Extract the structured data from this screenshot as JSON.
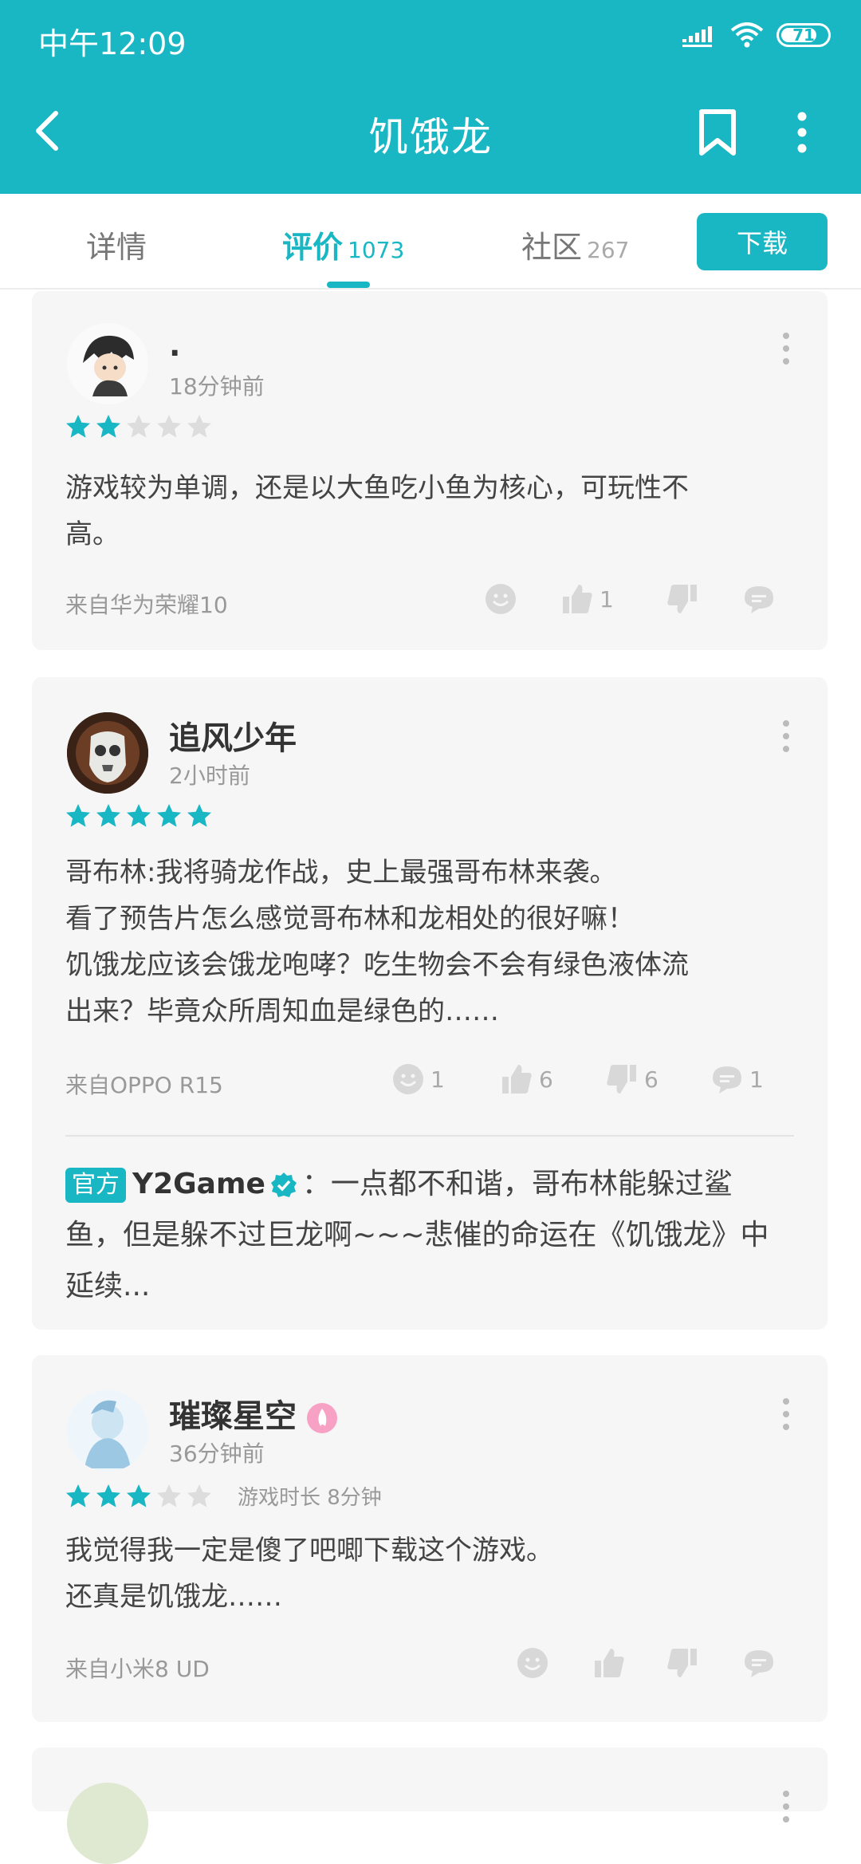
{
  "status_bar": {
    "time": "中午12:09",
    "battery": "71"
  },
  "header": {
    "title": "饥饿龙"
  },
  "tabs": [
    {
      "label": "详情",
      "count": ""
    },
    {
      "label": "评价",
      "count": "1073"
    },
    {
      "label": "社区",
      "count": "267"
    }
  ],
  "download_label": "下载",
  "colors": {
    "accent": "#19b6c4",
    "star_on": "#19b6c4",
    "star_off": "#dddddd",
    "card_bg": "#f6f6f6"
  },
  "reviews": [
    {
      "username": ".",
      "time": "18分钟前",
      "rating": 2,
      "text_lines": [
        "游戏较为单调，还是以大鱼吃小鱼为核心，可玩性不",
        "高。"
      ],
      "source": "来自华为荣耀10",
      "likes": "1"
    },
    {
      "username": "追风少年",
      "time": "2小时前",
      "rating": 5,
      "text_lines": [
        "哥布林:我将骑龙作战，史上最强哥布林来袭。",
        "看了预告片怎么感觉哥布林和龙相处的很好嘛！",
        "饥饿龙应该会饿龙咆哮？吃生物会不会有绿色液体流",
        "出来？毕竟众所周知血是绿色的……"
      ],
      "source": "来自OPPO R15",
      "emoji_count": "1",
      "likes": "6",
      "dislikes": "6",
      "comments": "1",
      "reply": {
        "badge": "官方",
        "name": "Y2Game",
        "lines": [
          "：一点都不和谐，哥布林能躲过鲨",
          "鱼，但是躲不过巨龙啊~~~悲催的命运在《饥饿龙》中",
          "延续..."
        ]
      }
    },
    {
      "username": "璀璨星空",
      "time": "36分钟前",
      "rating": 3,
      "play_time": "游戏时长 8分钟",
      "text_lines": [
        "我觉得我一定是傻了吧唧下载这个游戏。",
        "还真是饥饿龙……"
      ],
      "source": "来自小米8 UD"
    }
  ]
}
